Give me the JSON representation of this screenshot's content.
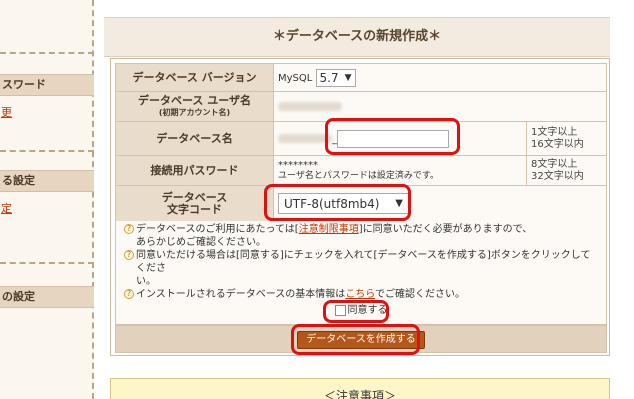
{
  "sidebar": {
    "section1": {
      "heading": "スワード",
      "link": "更"
    },
    "section2": {
      "heading": "る設定",
      "link": "定"
    },
    "section3": {
      "heading": "の設定"
    }
  },
  "page": {
    "title": "＊データベースの新規作成＊"
  },
  "form": {
    "version": {
      "label": "データベース バージョン",
      "prefix": "MySQL",
      "selected": "5.7"
    },
    "username": {
      "label": "データベース ユーザ名",
      "sublabel": "(初期アカウント名)"
    },
    "dbname": {
      "label": "データベース名",
      "prefix": "_",
      "note1": "1文字以上",
      "note2": "16文字以内"
    },
    "password": {
      "label": "接続用パスワード",
      "masked": "********",
      "status": "ユーザ名とパスワードは設定済みです。",
      "note1": "8文字以上",
      "note2": "32文字以内"
    },
    "charset": {
      "label1": "データベース",
      "label2": "文字コード",
      "selected": "UTF-8(utf8mb4)"
    }
  },
  "notices": {
    "n1_before": "データベースのご利用にあたっては[",
    "n1_link": "注意制限事項",
    "n1_after": "]に同意いただく必要がありますので、",
    "n1_line2": "あらかじめご確認ください。",
    "n2": "同意いただける場合は[同意する]にチェックを入れて[データベースを作成する]ボタンをクリックしてくださ",
    "n2_line2": "い。",
    "n3_before": "インストールされるデータベースの基本情報は",
    "n3_link": "こちら",
    "n3_after": "でご確認ください。",
    "agree_label": "同意する"
  },
  "submit_label": "データベースを作成する",
  "caution_title": "＜注意事項＞",
  "colors": {
    "highlight": "#e01010",
    "button": "#b3581a",
    "link": "#cc3300"
  }
}
